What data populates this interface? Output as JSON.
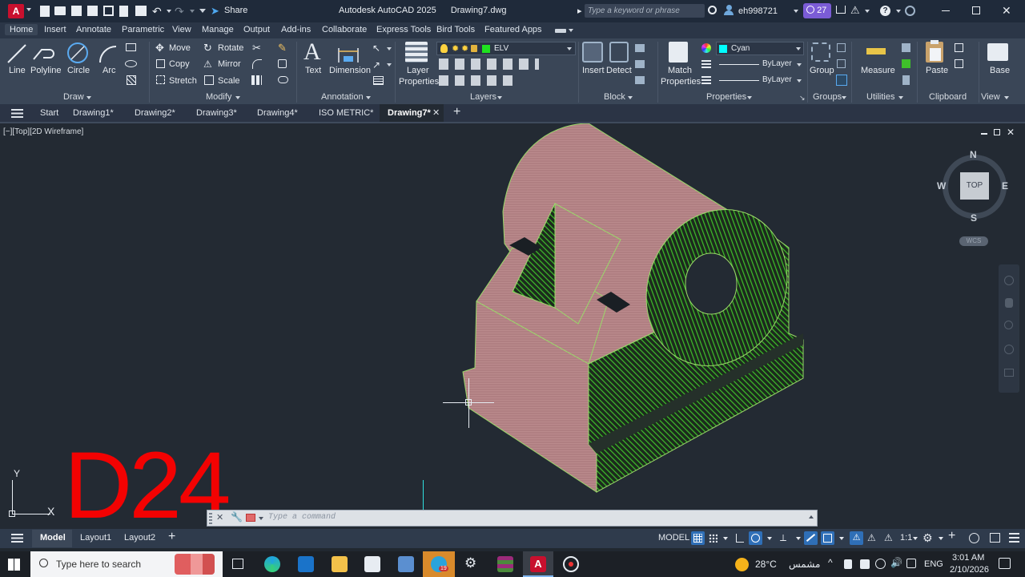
{
  "titlebar": {
    "app_badge": "A",
    "share_label": "Share",
    "title": "Autodesk AutoCAD 2025",
    "filename": "Drawing7.dwg",
    "search_placeholder": "Type a keyword or phrase",
    "user": "eh998721",
    "notif_count": "27"
  },
  "ribbon_tabs": [
    "Home",
    "Insert",
    "Annotate",
    "Parametric",
    "View",
    "Manage",
    "Output",
    "Add-ins",
    "Collaborate",
    "Express Tools",
    "Bird Tools",
    "Featured Apps"
  ],
  "ribbon": {
    "draw": {
      "title": "Draw",
      "line": "Line",
      "polyline": "Polyline",
      "circle": "Circle",
      "arc": "Arc"
    },
    "modify": {
      "title": "Modify",
      "move": "Move",
      "rotate": "Rotate",
      "copy": "Copy",
      "mirror": "Mirror",
      "stretch": "Stretch",
      "scale": "Scale"
    },
    "annotation": {
      "title": "Annotation",
      "text": "Text",
      "dimension": "Dimension"
    },
    "layers": {
      "title": "Layers",
      "layer_properties_1": "Layer",
      "layer_properties_2": "Properties",
      "current_layer": "ELV"
    },
    "block": {
      "title": "Block",
      "insert": "Insert",
      "detect": "Detect"
    },
    "properties": {
      "title": "Properties",
      "match_1": "Match",
      "match_2": "Properties",
      "color": "Cyan",
      "linetype": "ByLayer",
      "lineweight": "ByLayer"
    },
    "groups": {
      "title": "Groups",
      "group": "Group"
    },
    "utilities": {
      "title": "Utilities",
      "measure": "Measure"
    },
    "clipboard": {
      "title": "Clipboard",
      "paste": "Paste"
    },
    "view": {
      "title": "View",
      "base": "Base"
    }
  },
  "file_tabs": [
    "Start",
    "Drawing1*",
    "Drawing2*",
    "Drawing3*",
    "Drawing4*",
    "ISO METRIC*",
    "Drawing7*"
  ],
  "viewport": {
    "label": "[−][Top][2D Wireframe]",
    "compass": {
      "n": "N",
      "s": "S",
      "e": "E",
      "w": "W",
      "face": "TOP",
      "wcs": "WCS"
    },
    "watermark": "D24",
    "ucs_x": "X",
    "ucs_y": "Y"
  },
  "command": {
    "placeholder": "Type a command"
  },
  "layout_tabs": [
    "Model",
    "Layout1",
    "Layout2"
  ],
  "status": {
    "model": "MODEL",
    "scale": "1:1"
  },
  "taskbar": {
    "search_placeholder": "Type here to search",
    "weather_temp": "28°C",
    "weather_desc": "مشمس",
    "lang": "ENG",
    "time": "3:01 AM",
    "date": "2/10/2026",
    "acad_badge": "19"
  },
  "colors": {
    "accent": "#2f8fe3",
    "hatch_green": "#3fbf2a",
    "face_pink": "#b07f82",
    "watermark_red": "#ff0000"
  }
}
